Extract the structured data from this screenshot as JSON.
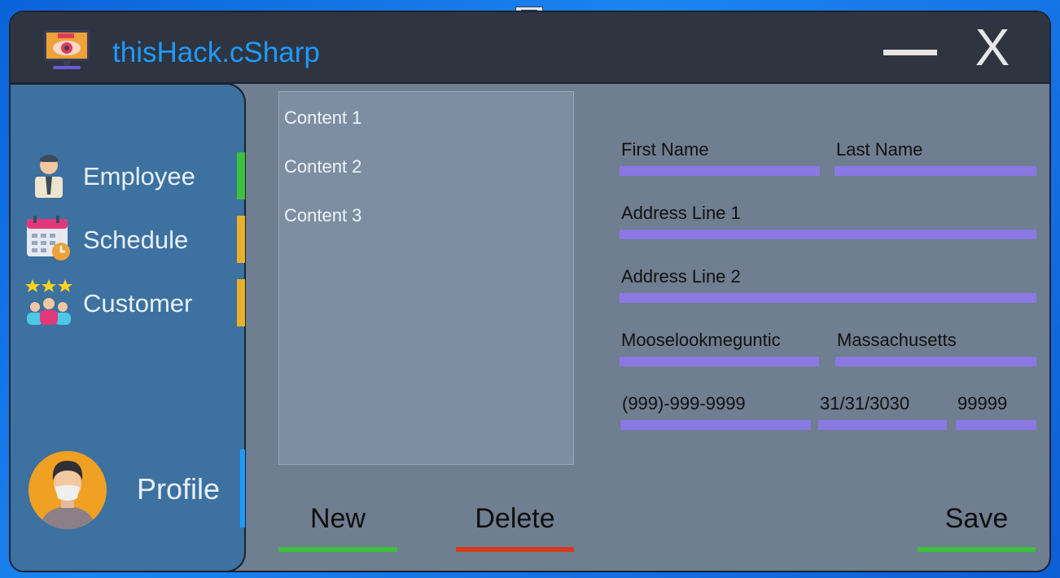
{
  "app": {
    "title": "thisHack.cSharp"
  },
  "window_controls": {
    "minimize_icon": "minimize-icon",
    "close_label": "X"
  },
  "sidebar": {
    "items": [
      {
        "label": "Employee",
        "icon": "employee-icon",
        "indicator_color": "#3cc13a"
      },
      {
        "label": "Schedule",
        "icon": "calendar-icon",
        "indicator_color": "#e8b12a"
      },
      {
        "label": "Customer",
        "icon": "customers-icon",
        "indicator_color": "#e8b12a"
      }
    ],
    "profile": {
      "label": "Profile",
      "icon": "avatar-icon",
      "indicator_color": "#1e9bff"
    }
  },
  "content_list": {
    "items": [
      "Content 1",
      "Content 2",
      "Content 3"
    ]
  },
  "form": {
    "first_name": "First Name",
    "last_name": "Last Name",
    "address_line_1": "Address Line 1",
    "address_line_2": "Address Line 2",
    "city": "Mooselookmeguntic",
    "state": "Massachusetts",
    "phone": "(999)-999-9999",
    "date": "31/31/3030",
    "zip": "99999",
    "underline_color": "#8a78e3"
  },
  "actions": {
    "new": {
      "label": "New",
      "color": "#3cc13a"
    },
    "delete": {
      "label": "Delete",
      "color": "#d63a1a"
    },
    "save": {
      "label": "Save",
      "color": "#3cc13a"
    }
  }
}
